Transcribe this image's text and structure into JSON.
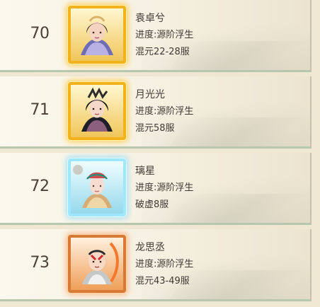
{
  "leaderboard": {
    "rows": [
      {
        "rank": "70",
        "name": "袁卓兮",
        "progress": "进度:源阶浮生",
        "server": "混元22-28服",
        "frame_color": "#f2b21c"
      },
      {
        "rank": "71",
        "name": "月光光",
        "progress": "进度:源阶浮生",
        "server": "混元58服",
        "frame_color": "#f2b21c"
      },
      {
        "rank": "72",
        "name": "璃星",
        "progress": "进度:源阶浮生",
        "server": "破虚8服",
        "frame_color": "#9fe7ff"
      },
      {
        "rank": "73",
        "name": "龙思丞",
        "progress": "进度:源阶浮生",
        "server": "混元43-49服",
        "frame_color": "#d67a35"
      }
    ]
  }
}
